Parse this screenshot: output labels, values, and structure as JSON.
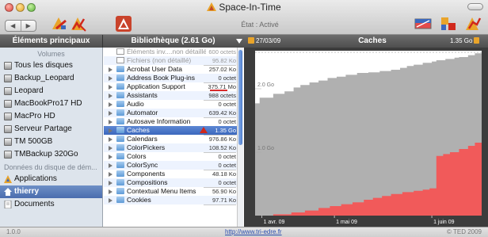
{
  "window": {
    "title": "Space-In-Time",
    "status": "État : Activé"
  },
  "toolbar": {
    "back_icon": "chevron-left-icon",
    "forward_icon": "chevron-right-icon"
  },
  "header": {
    "left": "Éléments principaux",
    "middle": "Bibliothèque (2.61 Go)",
    "date": "27/03/09",
    "chart_title": "Caches",
    "size": "1.35 Go"
  },
  "sidebar": {
    "section_volumes": "Volumes",
    "volumes": [
      {
        "label": "Tous les disques"
      },
      {
        "label": "Backup_Leopard"
      },
      {
        "label": "Leopard"
      },
      {
        "label": "MacBookPro17 HD"
      },
      {
        "label": "MacPro HD"
      },
      {
        "label": "Serveur Partage"
      },
      {
        "label": "TM 500GB"
      },
      {
        "label": "TMBackup 320Go"
      }
    ],
    "section_data": "Données du disque de dém...",
    "data_items": [
      {
        "label": "Applications"
      },
      {
        "label": "thierry"
      },
      {
        "label": "Documents"
      }
    ]
  },
  "files": [
    {
      "name": "Éléments inv....non détaillé)",
      "size": "600 octets",
      "type": "doc",
      "grey": true
    },
    {
      "name": "Fichiers (non détaillé)",
      "size": "95.82 Ko",
      "type": "doc",
      "grey": true
    },
    {
      "name": "Acrobat User Data",
      "size": "257.02 Ko",
      "type": "folder"
    },
    {
      "name": "Address Book Plug-ins",
      "size": "0 octet",
      "type": "folder"
    },
    {
      "name": "Application Support",
      "size": "375.71 Mo",
      "type": "folder"
    },
    {
      "name": "Assistants",
      "size": "988 octets",
      "type": "folder"
    },
    {
      "name": "Audio",
      "size": "0 octet",
      "type": "folder"
    },
    {
      "name": "Automator",
      "size": "639.42 Ko",
      "type": "folder"
    },
    {
      "name": "Autosave Information",
      "size": "0 octet",
      "type": "folder"
    },
    {
      "name": "Caches",
      "size": "1.35 Go",
      "type": "folder",
      "selected": true
    },
    {
      "name": "Calendars",
      "size": "976.86 Ko",
      "type": "folder"
    },
    {
      "name": "ColorPickers",
      "size": "108.52 Ko",
      "type": "folder"
    },
    {
      "name": "Colors",
      "size": "0 octet",
      "type": "folder"
    },
    {
      "name": "ColorSync",
      "size": "0 octet",
      "type": "folder"
    },
    {
      "name": "Components",
      "size": "48.18 Ko",
      "type": "folder"
    },
    {
      "name": "Compositions",
      "size": "0 octet",
      "type": "folder"
    },
    {
      "name": "Contextual Menu Items",
      "size": "56.90 Ko",
      "type": "folder"
    },
    {
      "name": "Cookies",
      "size": "97.71 Ko",
      "type": "folder"
    }
  ],
  "chart_data": {
    "type": "area",
    "title": "Caches",
    "y_ticks": [
      "2.0 Go",
      "1.0 Go"
    ],
    "x_ticks": [
      "1 avr. 09",
      "1 mai 09",
      "1 juin 09"
    ],
    "ylim": [
      0,
      2.6
    ],
    "series": [
      {
        "color": "#b0b0b0",
        "x": [
          0,
          0.02,
          0.08,
          0.13,
          0.17,
          0.2,
          0.24,
          0.28,
          0.32,
          0.36,
          0.4,
          0.45,
          0.5,
          0.55,
          0.6,
          0.64,
          0.67,
          0.7,
          0.74,
          0.78,
          0.8,
          0.84,
          0.88,
          0.9,
          0.94,
          0.97,
          1.0
        ],
        "values": [
          1.77,
          1.86,
          1.92,
          1.96,
          2.02,
          2.06,
          2.1,
          2.13,
          2.17,
          2.19,
          2.22,
          2.25,
          2.26,
          2.28,
          2.3,
          2.33,
          2.36,
          2.38,
          2.41,
          2.43,
          2.45,
          2.47,
          2.49,
          2.5,
          2.53,
          2.56,
          2.58
        ]
      },
      {
        "color": "#f15a5a",
        "x": [
          0,
          0.08,
          0.16,
          0.22,
          0.28,
          0.33,
          0.38,
          0.43,
          0.48,
          0.52,
          0.56,
          0.6,
          0.65,
          0.7,
          0.74,
          0.77,
          0.8,
          0.83,
          0.86,
          0.9,
          0.94,
          0.97,
          1.0
        ],
        "values": [
          0.0,
          0.02,
          0.05,
          0.08,
          0.12,
          0.15,
          0.18,
          0.21,
          0.25,
          0.28,
          0.31,
          0.34,
          0.37,
          0.39,
          0.41,
          0.43,
          0.94,
          0.97,
          1.0,
          1.05,
          1.1,
          1.15,
          1.35
        ]
      }
    ]
  },
  "footer": {
    "version": "1.0.0",
    "url": "http://www.tri-edre.fr",
    "copyright": "© TED 2009"
  }
}
